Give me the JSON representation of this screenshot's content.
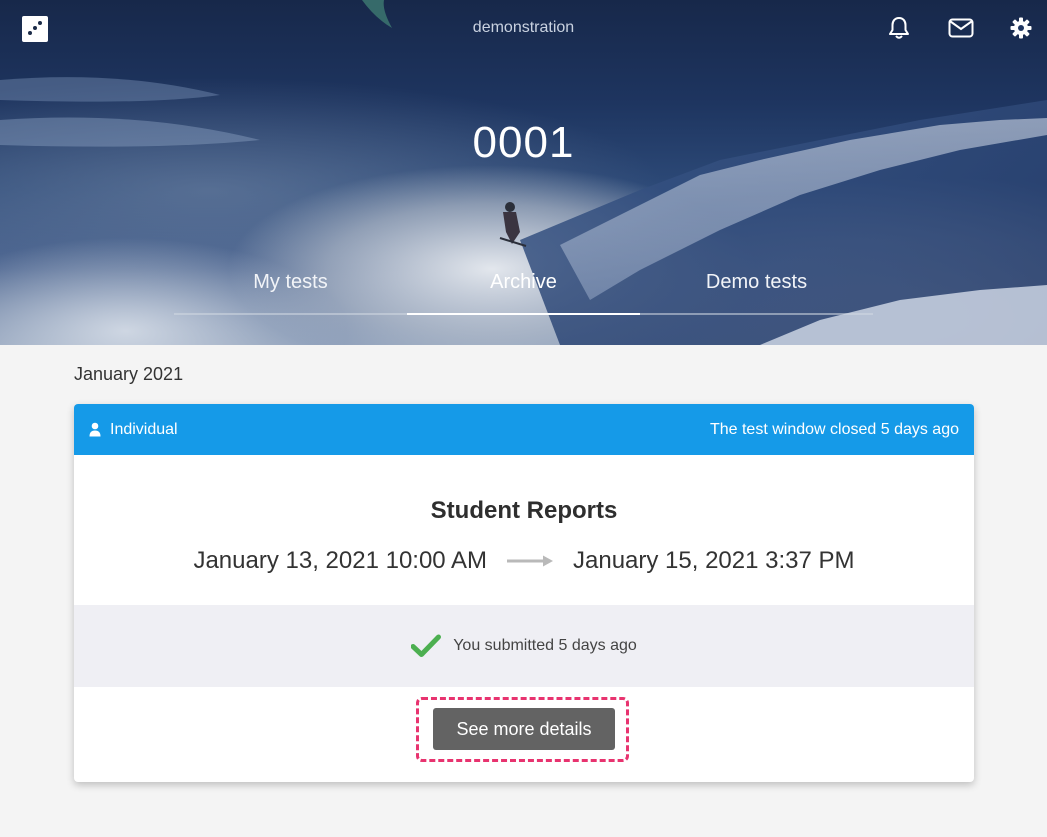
{
  "header": {
    "org_name": "demonstration",
    "page_title": "0001",
    "icons": [
      "bell-icon",
      "mail-icon",
      "gear-icon"
    ]
  },
  "tabs": [
    {
      "label": "My tests",
      "active": false
    },
    {
      "label": "Archive",
      "active": true
    },
    {
      "label": "Demo tests",
      "active": false
    }
  ],
  "month_label": "January 2021",
  "card": {
    "type_label": "Individual",
    "window_status": "The test window closed 5 days ago",
    "title": "Student Reports",
    "start": "January 13, 2021 10:00 AM",
    "end": "January 15, 2021 3:37 PM",
    "submission_status": "You submitted 5 days ago",
    "button_label": "See more details"
  },
  "colors": {
    "card_header": "#159ae8",
    "check": "#4caf50",
    "button": "#636363",
    "highlight": "#e8336f"
  }
}
